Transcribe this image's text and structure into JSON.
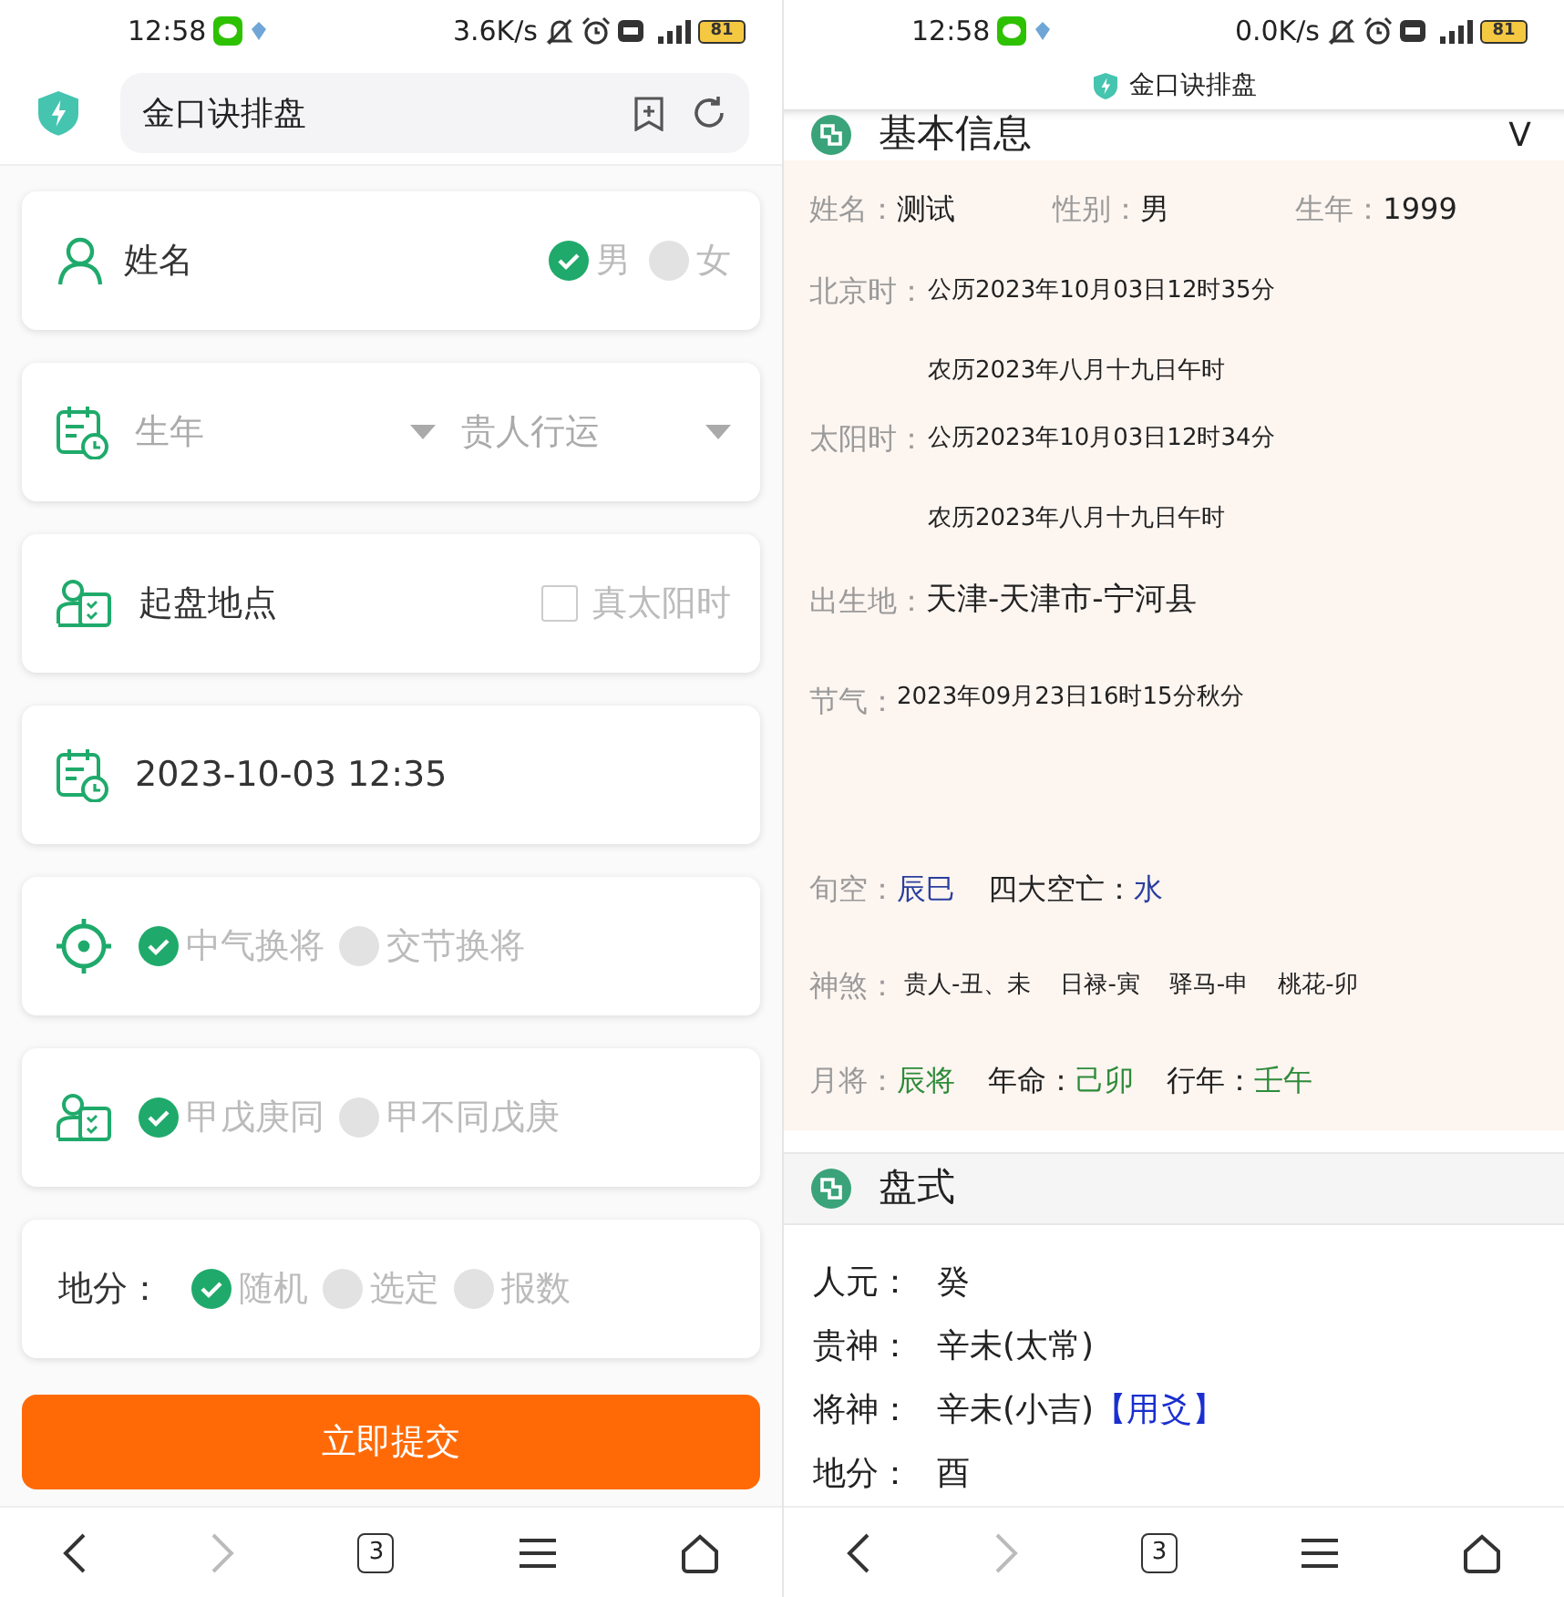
{
  "left": {
    "status_bar": {
      "time": "12:58",
      "speed": "3.6K/s",
      "battery": "81"
    },
    "address_bar": {
      "title": "金口诀排盘"
    },
    "form": [
      {
        "kind": "name",
        "placeholder": "姓名",
        "options": [
          {
            "label": "男",
            "selected": true
          },
          {
            "label": "女",
            "selected": false
          }
        ]
      },
      {
        "kind": "year",
        "selects": [
          {
            "placeholder": "生年"
          },
          {
            "placeholder": "贵人行运"
          }
        ]
      },
      {
        "kind": "place",
        "placeholder": "起盘地点",
        "checkbox": {
          "label": "真太阳时",
          "checked": false
        }
      },
      {
        "kind": "time",
        "value": "2023-10-03 12:35"
      },
      {
        "kind": "general",
        "options": [
          {
            "label": "中气换将",
            "selected": true
          },
          {
            "label": "交节换将",
            "selected": false
          }
        ]
      },
      {
        "kind": "stems",
        "options": [
          {
            "label": "甲戊庚同",
            "selected": true
          },
          {
            "label": "甲不同戊庚",
            "selected": false
          }
        ]
      },
      {
        "kind": "branch",
        "label": "地分：",
        "options": [
          {
            "label": "随机",
            "selected": true
          },
          {
            "label": "选定",
            "selected": false
          },
          {
            "label": "报数",
            "selected": false
          }
        ]
      }
    ],
    "submit_button": "立即提交",
    "nav_bar": {
      "back_disabled": false,
      "forward_disabled": true,
      "tab_count": "3"
    }
  },
  "right": {
    "status_bar": {
      "time": "12:58",
      "speed": "0.0K/s",
      "battery": "81"
    },
    "page_title": "金口诀排盘",
    "basic_info": {
      "title": "基本信息",
      "toggle": "V",
      "rows": [
        {
          "kind": "pairs",
          "pairs": [
            {
              "label": "姓名：",
              "value": "测试"
            },
            {
              "label": "性别：",
              "value": "男"
            },
            {
              "label": "生年：",
              "value": "1999"
            }
          ]
        },
        {
          "kind": "dates",
          "label": "北京时：",
          "lines": [
            "公历2023年10月03日12时35分",
            "农历2023年八月十九日午时"
          ]
        },
        {
          "kind": "dates",
          "label": "太阳时：",
          "lines": [
            "公历2023年10月03日12时34分",
            "农历2023年八月十九日午时"
          ]
        },
        {
          "kind": "text",
          "label": "出生地：",
          "value": "天津-天津市-宁河县"
        },
        {
          "kind": "term",
          "label": "节气：",
          "value": "2023年09月23日16时15分秋分"
        },
        {
          "kind": "spans",
          "label": "旬空：",
          "spans": [
            {
              "text": "辰巳",
              "color": "#2b3f9e"
            },
            {
              "text": "四大空亡：",
              "color": "#222222"
            },
            {
              "text": "水",
              "color": "#2b3f9e"
            }
          ]
        },
        {
          "kind": "list",
          "label": "神煞：",
          "items": [
            "贵人-丑、未",
            "日禄-寅",
            "驿马-申",
            "桃花-卯"
          ]
        },
        {
          "kind": "spans",
          "label": "月将：",
          "spans": [
            {
              "text": "辰将",
              "color": "#2e8b3a"
            },
            {
              "text": "年命：",
              "color": "#222222"
            },
            {
              "text": "己卯",
              "color": "#2e8b3a"
            },
            {
              "text": "行年：",
              "color": "#222222"
            },
            {
              "text": "壬午",
              "color": "#2e8b3a"
            }
          ]
        }
      ]
    },
    "layout": {
      "title": "盘式",
      "rows": [
        {
          "label": "人元：",
          "value": "癸"
        },
        {
          "label": "贵神：",
          "value": "辛未(太常)"
        },
        {
          "label": "将神：",
          "value": "辛未(小吉)",
          "tag": "【用爻】"
        },
        {
          "label": "地分：",
          "value": "酉"
        }
      ]
    },
    "nav_bar": {
      "back_disabled": false,
      "forward_disabled": true,
      "tab_count": "3"
    }
  }
}
